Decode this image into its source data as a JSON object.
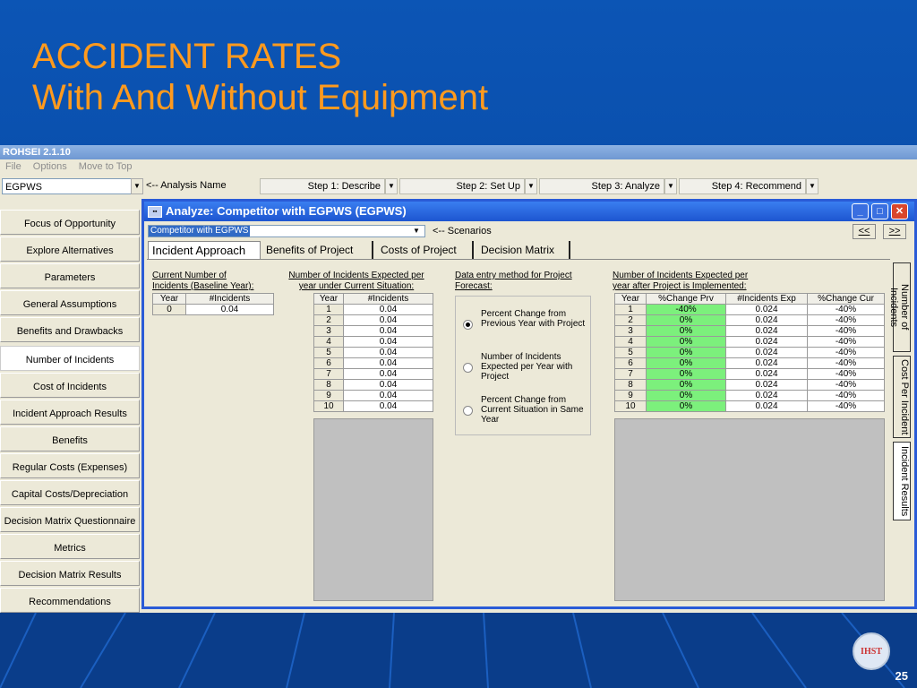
{
  "slide": {
    "title_line1": "ACCIDENT RATES",
    "title_line2": "With  And Without Equipment",
    "page_number": "25",
    "logo_text": "IHST"
  },
  "app": {
    "title": "ROHSEI 2.1.10",
    "menu": [
      "File",
      "Options",
      "Move to Top"
    ],
    "analysis_name_value": "EGPWS",
    "analysis_name_label": "<-- Analysis Name",
    "steps": [
      "Step 1: Describe",
      "Step 2: Set Up",
      "Step 3: Analyze",
      "Step 4: Recommend"
    ]
  },
  "sidebar": {
    "items": [
      "Focus of Opportunity",
      "Explore Alternatives",
      "Parameters",
      "General Assumptions",
      "Benefits and Drawbacks",
      "Number of Incidents",
      "Cost of Incidents",
      "Incident Approach Results",
      "Benefits",
      "Regular Costs (Expenses)",
      "Capital Costs/Depreciation",
      "Decision Matrix Questionnaire",
      "Metrics",
      "Decision Matrix Results",
      "Recommendations"
    ],
    "active_index": 5
  },
  "child": {
    "title": "Analyze: Competitor with EGPWS (EGPWS)",
    "scenario_value": "Competitor with EGPWS",
    "scenario_label": "<-- Scenarios",
    "prev_label": "<<",
    "next_label": ">>",
    "tabs": [
      "Incident Approach",
      "Benefits of Project",
      "Costs of Project",
      "Decision Matrix"
    ],
    "vertical_tabs": [
      "Number of Incidents",
      "Cost Per Incident",
      "Incident Results"
    ]
  },
  "baseline": {
    "label_line1": "Current Number of",
    "label_line2": "Incidents (Baseline Year):",
    "headers": [
      "Year",
      "#Incidents"
    ],
    "rows": [
      [
        "0",
        "0.04"
      ]
    ]
  },
  "current": {
    "label_line1": "Number of Incidents Expected per",
    "label_line2": "year under Current Situation:",
    "headers": [
      "Year",
      "#Incidents"
    ],
    "rows": [
      [
        "1",
        "0.04"
      ],
      [
        "2",
        "0.04"
      ],
      [
        "3",
        "0.04"
      ],
      [
        "4",
        "0.04"
      ],
      [
        "5",
        "0.04"
      ],
      [
        "6",
        "0.04"
      ],
      [
        "7",
        "0.04"
      ],
      [
        "8",
        "0.04"
      ],
      [
        "9",
        "0.04"
      ],
      [
        "10",
        "0.04"
      ]
    ]
  },
  "method": {
    "label_line1": "Data entry method for Project",
    "label_line2": "Forecast:",
    "options": [
      {
        "text": "Percent Change from Previous Year with Project",
        "selected": true
      },
      {
        "text": "Number of Incidents Expected per Year with Project",
        "selected": false
      },
      {
        "text": "Percent Change from Current Situation in Same Year",
        "selected": false
      }
    ]
  },
  "project": {
    "label_line1": "Number of Incidents Expected per",
    "label_line2": "year after Project is Implemented:",
    "headers": [
      "Year",
      "%Change Prv",
      "#Incidents Exp",
      "%Change Cur"
    ],
    "rows": [
      [
        "1",
        "-40%",
        "0.024",
        "-40%"
      ],
      [
        "2",
        "0%",
        "0.024",
        "-40%"
      ],
      [
        "3",
        "0%",
        "0.024",
        "-40%"
      ],
      [
        "4",
        "0%",
        "0.024",
        "-40%"
      ],
      [
        "5",
        "0%",
        "0.024",
        "-40%"
      ],
      [
        "6",
        "0%",
        "0.024",
        "-40%"
      ],
      [
        "7",
        "0%",
        "0.024",
        "-40%"
      ],
      [
        "8",
        "0%",
        "0.024",
        "-40%"
      ],
      [
        "9",
        "0%",
        "0.024",
        "-40%"
      ],
      [
        "10",
        "0%",
        "0.024",
        "-40%"
      ]
    ]
  },
  "colors": {
    "title_orange": "#ff9a1e",
    "slide_blue": "#0a4aa0",
    "green_cell": "#7cf07c",
    "window_blue": "#2a5bd7"
  }
}
